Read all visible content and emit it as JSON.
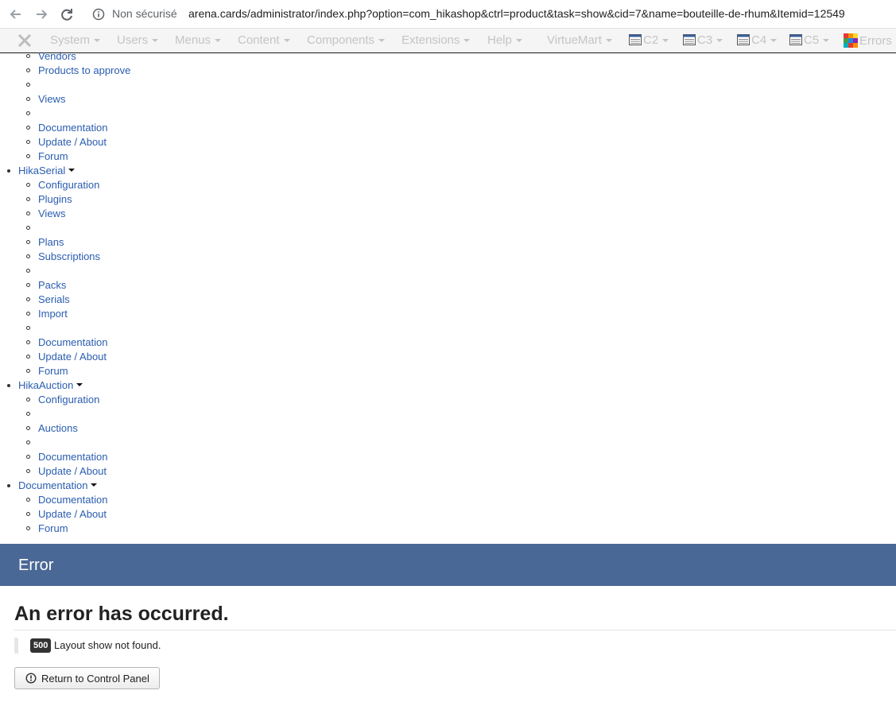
{
  "browser": {
    "security_label": "Non sécurisé",
    "url": "arena.cards/administrator/index.php?option=com_hikashop&ctrl=product&task=show&cid=7&name=bouteille-de-rhum&Itemid=12549"
  },
  "admin_menu": {
    "items": [
      "System",
      "Users",
      "Menus",
      "Content",
      "Components",
      "Extensions",
      "Help"
    ],
    "virtuemart": "VirtueMart",
    "c_items": [
      "C2",
      "C3",
      "C4",
      "C5"
    ],
    "errors": "Errors"
  },
  "menu_list": [
    {
      "level": "sub",
      "label": "Vendors"
    },
    {
      "level": "sub",
      "label": "Products to approve"
    },
    {
      "level": "sub",
      "label": ""
    },
    {
      "level": "sub",
      "label": "Views"
    },
    {
      "level": "sub",
      "label": ""
    },
    {
      "level": "sub",
      "label": "Documentation"
    },
    {
      "level": "sub",
      "label": "Update / About"
    },
    {
      "level": "sub",
      "label": "Forum"
    },
    {
      "level": "top",
      "label": "HikaSerial"
    },
    {
      "level": "sub",
      "label": "Configuration"
    },
    {
      "level": "sub",
      "label": "Plugins"
    },
    {
      "level": "sub",
      "label": "Views"
    },
    {
      "level": "sub",
      "label": ""
    },
    {
      "level": "sub",
      "label": "Plans"
    },
    {
      "level": "sub",
      "label": "Subscriptions"
    },
    {
      "level": "sub",
      "label": ""
    },
    {
      "level": "sub",
      "label": "Packs"
    },
    {
      "level": "sub",
      "label": "Serials"
    },
    {
      "level": "sub",
      "label": "Import"
    },
    {
      "level": "sub",
      "label": ""
    },
    {
      "level": "sub",
      "label": "Documentation"
    },
    {
      "level": "sub",
      "label": "Update / About"
    },
    {
      "level": "sub",
      "label": "Forum"
    },
    {
      "level": "top",
      "label": "HikaAuction"
    },
    {
      "level": "sub",
      "label": "Configuration"
    },
    {
      "level": "sub",
      "label": ""
    },
    {
      "level": "sub",
      "label": "Auctions"
    },
    {
      "level": "sub",
      "label": ""
    },
    {
      "level": "sub",
      "label": "Documentation"
    },
    {
      "level": "sub",
      "label": "Update / About"
    },
    {
      "level": "top",
      "label": "Documentation"
    },
    {
      "level": "sub",
      "label": "Documentation"
    },
    {
      "level": "sub",
      "label": "Update / About"
    },
    {
      "level": "sub",
      "label": "Forum"
    }
  ],
  "error": {
    "header": "Error",
    "title": "An error has occurred.",
    "code": "500",
    "message": "Layout show not found.",
    "return_button": "Return to Control Panel"
  },
  "colors": {
    "link": "#2a5db0",
    "error_header_bg": "#4a6895"
  }
}
